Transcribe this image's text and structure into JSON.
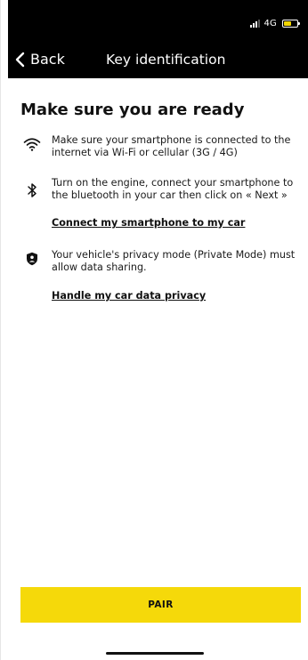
{
  "status_bar": {
    "network": "4G",
    "battery_level": 0.5,
    "battery_color": "#f2d600"
  },
  "nav": {
    "back_label": "Back",
    "title": "Key identification"
  },
  "main": {
    "title": "Make sure you are ready",
    "steps": [
      {
        "icon": "wifi-icon",
        "text": "Make sure your smartphone is connected to the internet via Wi-Fi or cellular (3G / 4G)"
      },
      {
        "icon": "bluetooth-icon",
        "text": "Turn on the engine, connect your smartphone to the bluetooth in your car then click on « Next »",
        "link": "Connect my smartphone to my car"
      },
      {
        "icon": "shield-icon",
        "text": "Your vehicle's privacy mode (Private Mode) must allow data sharing.",
        "link": "Handle my car data privacy"
      }
    ]
  },
  "pair_button": {
    "label": "PAIR",
    "color": "#f5d90a"
  }
}
